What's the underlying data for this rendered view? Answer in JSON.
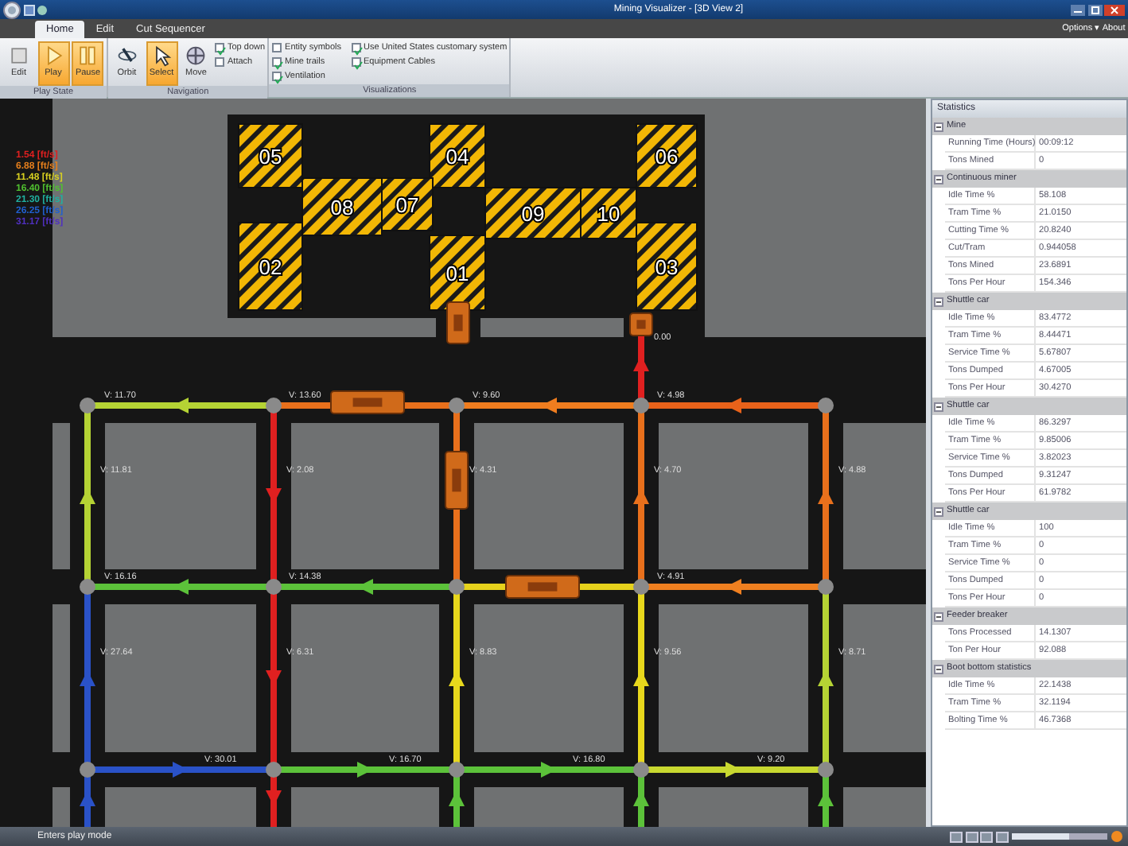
{
  "window": {
    "title": "Mining Visualizer - [3D View 2]"
  },
  "tabs": [
    {
      "label": "Home",
      "selected": true
    },
    {
      "label": "Edit",
      "selected": false
    },
    {
      "label": "Cut Sequencer",
      "selected": false
    }
  ],
  "menu_right": [
    "Options ▾",
    "About"
  ],
  "ribbon": {
    "groups": [
      {
        "label": "Play State",
        "buttons": [
          {
            "label": "Edit",
            "selected": false
          },
          {
            "label": "Play",
            "selected": true
          },
          {
            "label": "Pause",
            "selected": true
          }
        ]
      },
      {
        "label": "Navigation",
        "buttons": [
          {
            "label": "Orbit",
            "selected": false
          },
          {
            "label": "Select",
            "selected": true
          },
          {
            "label": "Move",
            "selected": false
          }
        ],
        "checkboxes": [
          {
            "label": "Top down",
            "checked": true
          },
          {
            "label": "Attach",
            "checked": false
          }
        ]
      },
      {
        "label": "Visualizations",
        "checkboxes": [
          {
            "label": "Entity symbols",
            "checked": false
          },
          {
            "label": "Mine trails",
            "checked": true
          },
          {
            "label": "Ventilation",
            "checked": true
          },
          {
            "label": "Use United States customary system",
            "checked": true
          },
          {
            "label": "Equipment Cables",
            "checked": true
          }
        ]
      }
    ]
  },
  "legend": [
    {
      "label": "1.54 [ft/s]",
      "color": "#e02020"
    },
    {
      "label": "6.88 [ft/s]",
      "color": "#e8801c"
    },
    {
      "label": "11.48 [ft/s]",
      "color": "#d8d020"
    },
    {
      "label": "16.40 [ft/s]",
      "color": "#50c030"
    },
    {
      "label": "21.30 [ft/s]",
      "color": "#20b0a0"
    },
    {
      "label": "26.25 [ft/s]",
      "color": "#2060d0"
    },
    {
      "label": "31.17 [ft/s]",
      "color": "#5030c0"
    }
  ],
  "panels": [
    "05",
    "04",
    "06",
    "08",
    "07",
    "09",
    "10",
    "02",
    "01",
    "03"
  ],
  "roads": [
    {
      "color": "#b5d334",
      "label": "V: 11.70"
    },
    {
      "color": "#e8701c",
      "label": "V: 13.60"
    },
    {
      "color": "#ef7d1f",
      "label": "V: 9.60"
    },
    {
      "color": "#e8621a",
      "label": "V: 4.98"
    },
    {
      "color": "#5cc23a",
      "label": "V: 16.16"
    },
    {
      "color": "#5cc23a",
      "label": "V: 14.38"
    },
    {
      "color": "#e6d21c"
    },
    {
      "color": "#f08020",
      "label": "V: 4.91"
    },
    {
      "color": "#2a52c8",
      "label": "V: 30.01"
    },
    {
      "color": "#5cc23a",
      "label": "V: 16.70"
    },
    {
      "color": "#5cc23a",
      "label": "V: 16.80"
    },
    {
      "color": "#c8d830",
      "label": "V: 9.20"
    },
    {
      "color": "#b5d334",
      "label": "V: 11.81"
    },
    {
      "color": "#2a52c8",
      "label": "V: 27.64"
    },
    {
      "color": "#2a52c8"
    },
    {
      "color": "#e02020",
      "label": "V: 2.08"
    },
    {
      "color": "#e02020",
      "label": "V: 6.31"
    },
    {
      "color": "#e02020"
    },
    {
      "color": "#e8701c",
      "label": "V: 4.31"
    },
    {
      "color": "#e8d81c",
      "label": "V: 8.83"
    },
    {
      "color": "#5cc23a"
    },
    {
      "color": "#e02020",
      "label": "0.00"
    },
    {
      "color": "#e8701c",
      "label": "V: 4.70"
    },
    {
      "color": "#e8d81c",
      "label": "V: 9.56"
    },
    {
      "color": "#5cc23a"
    },
    {
      "color": "#e8701c",
      "label": "V: 4.88"
    },
    {
      "color": "#b5d334",
      "label": "V: 8.71"
    },
    {
      "color": "#5cc23a"
    }
  ],
  "statistics": {
    "title": "Statistics",
    "sections": [
      {
        "title": "Mine",
        "expanded": true,
        "rows": [
          {
            "name": "Running Time (Hours)",
            "value": "00:09:12"
          },
          {
            "name": "Tons Mined",
            "value": "0"
          }
        ]
      },
      {
        "title": "Continuous miner",
        "expanded": true,
        "rows": [
          {
            "name": "Idle Time %",
            "value": "58.108"
          },
          {
            "name": "Tram Time %",
            "value": "21.0150"
          },
          {
            "name": "Cutting Time %",
            "value": "20.8240"
          },
          {
            "name": "Cut/Tram",
            "value": "0.944058"
          },
          {
            "name": "Tons Mined",
            "value": "23.6891"
          },
          {
            "name": "Tons Per Hour",
            "value": "154.346"
          }
        ]
      },
      {
        "title": "Shuttle car",
        "expanded": true,
        "rows": [
          {
            "name": "Idle Time %",
            "value": "83.4772"
          },
          {
            "name": "Tram Time %",
            "value": "8.44471"
          },
          {
            "name": "Service Time %",
            "value": "5.67807"
          },
          {
            "name": "Tons Dumped",
            "value": "4.67005"
          },
          {
            "name": "Tons Per Hour",
            "value": "30.4270"
          }
        ]
      },
      {
        "title": "Shuttle car",
        "expanded": true,
        "rows": [
          {
            "name": "Idle Time %",
            "value": "86.3297"
          },
          {
            "name": "Tram Time %",
            "value": "9.85006"
          },
          {
            "name": "Service Time %",
            "value": "3.82023"
          },
          {
            "name": "Tons Dumped",
            "value": "9.31247"
          },
          {
            "name": "Tons Per Hour",
            "value": "61.9782"
          }
        ]
      },
      {
        "title": "Shuttle car",
        "expanded": true,
        "rows": [
          {
            "name": "Idle Time %",
            "value": "100"
          },
          {
            "name": "Tram Time %",
            "value": "0"
          },
          {
            "name": "Service Time %",
            "value": "0"
          },
          {
            "name": "Tons Dumped",
            "value": "0"
          },
          {
            "name": "Tons Per Hour",
            "value": "0"
          }
        ]
      },
      {
        "title": "Feeder breaker",
        "expanded": true,
        "rows": [
          {
            "name": "Tons Processed",
            "value": "14.1307"
          },
          {
            "name": "Ton Per Hour",
            "value": "92.088"
          }
        ]
      },
      {
        "title": "Boot bottom statistics",
        "expanded": true,
        "rows": [
          {
            "name": "Idle Time %",
            "value": "22.1438"
          },
          {
            "name": "Tram Time %",
            "value": "32.1194"
          },
          {
            "name": "Bolting Time %",
            "value": "46.7368"
          }
        ]
      }
    ]
  },
  "status_bar": {
    "text": "Enters play mode",
    "zoom": {
      "level": 0.6
    }
  }
}
